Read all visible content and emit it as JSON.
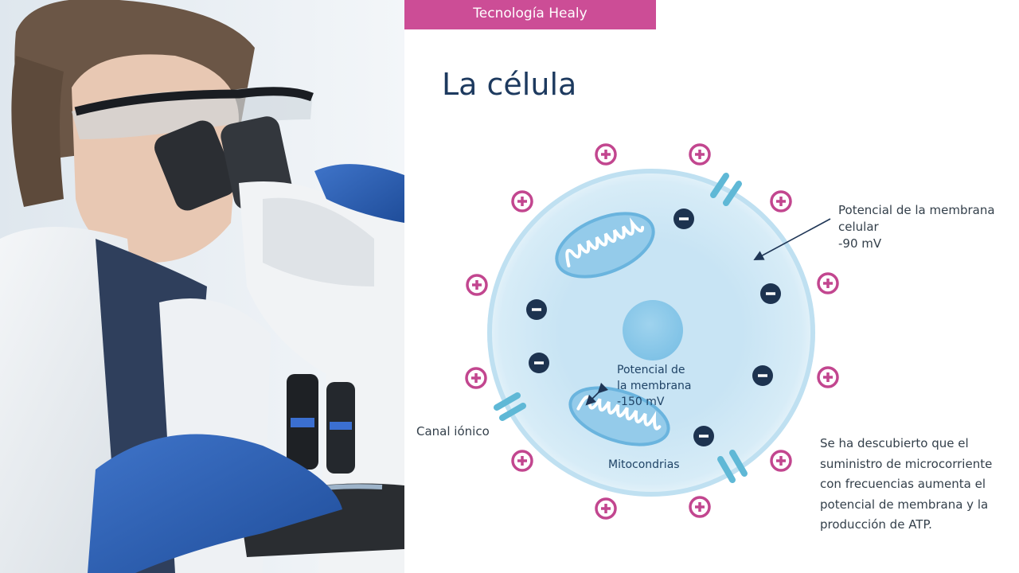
{
  "header": {
    "tag": "Tecnología Healy",
    "title": "La célula"
  },
  "labels": {
    "membrane_cell": [
      "Potencial de la membrana",
      "celular",
      "-90 mV"
    ],
    "membrane_mito": [
      "Potencial de",
      "la membrana",
      "-150 mV"
    ],
    "canal": "Canal iónico",
    "mito": "Mitocondrias",
    "note": [
      "Se ha descubierto que el",
      "suministro de microcorriente",
      "con frecuencias aumenta el",
      "potencial de membrana y la",
      "producción de ATP."
    ]
  },
  "icons": {
    "positive_charge": "plus-circle-icon",
    "negative_charge": "minus-circle-icon"
  },
  "colors": {
    "tag_bg": "#cc4d96",
    "title": "#1d3a5f",
    "positive": "#c2468f",
    "negative": "#1d3350",
    "cell": "#c5e3f3",
    "nucleus": "#8ccbea"
  }
}
